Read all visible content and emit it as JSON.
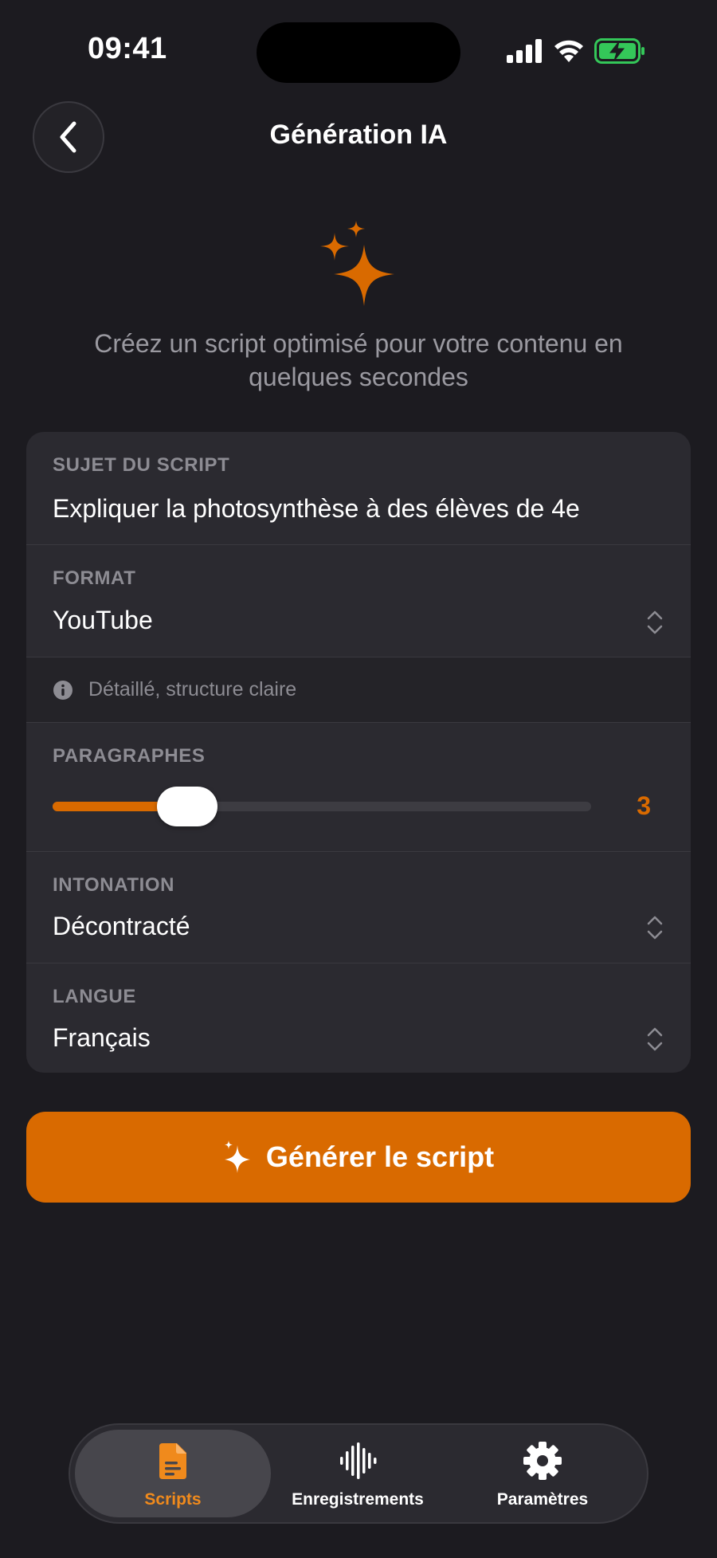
{
  "status": {
    "time": "09:41"
  },
  "header": {
    "title": "Génération IA"
  },
  "hero": {
    "subtitle": "Créez un script optimisé pour votre contenu en quelques secondes"
  },
  "form": {
    "subject": {
      "label": "SUJET DU SCRIPT",
      "value": "Expliquer la photosynthèse à des élèves de 4e"
    },
    "format": {
      "label": "FORMAT",
      "value": "YouTube",
      "info": "Détaillé, structure claire"
    },
    "paragraphs": {
      "label": "PARAGRAPHES",
      "value": "3",
      "fill_fraction": 0.25
    },
    "tone": {
      "label": "INTONATION",
      "value": "Décontracté"
    },
    "language": {
      "label": "LANGUE",
      "value": "Français"
    }
  },
  "generate_button": {
    "label": "Générer le script"
  },
  "tabbar": {
    "tabs": [
      {
        "label": "Scripts",
        "icon": "document-icon",
        "active": true
      },
      {
        "label": "Enregistrements",
        "icon": "waveform-icon",
        "active": false
      },
      {
        "label": "Paramètres",
        "icon": "gear-icon",
        "active": false
      }
    ]
  },
  "colors": {
    "accent": "#d96a00",
    "background": "#1c1b20",
    "card": "#2b2a30"
  }
}
